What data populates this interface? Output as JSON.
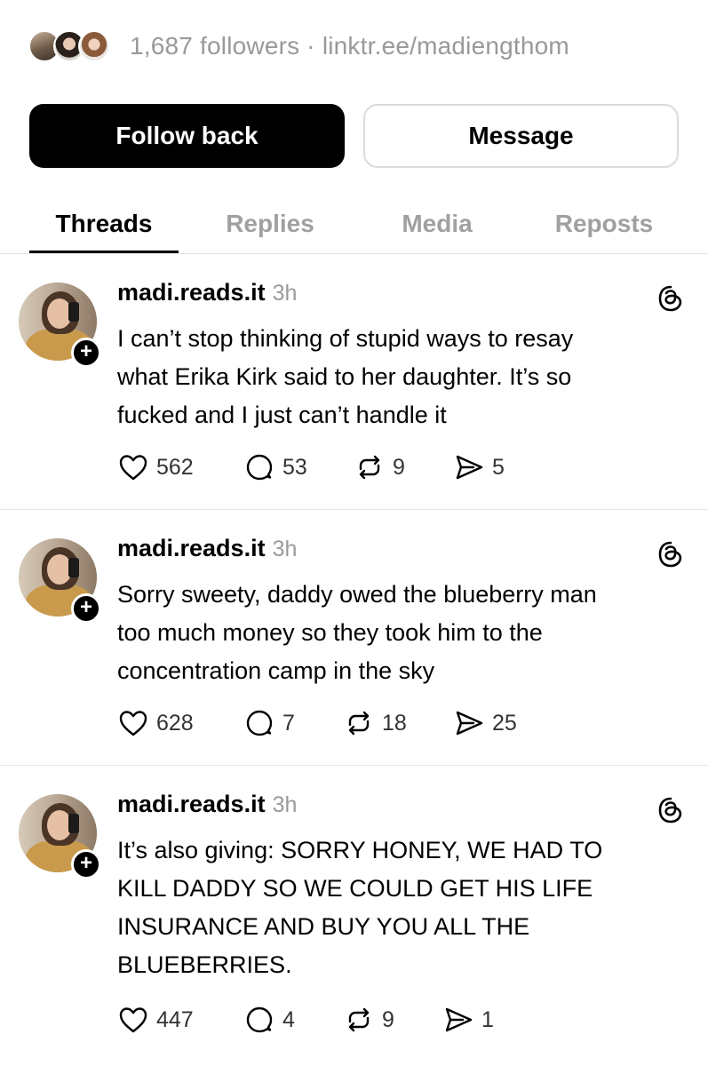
{
  "profile": {
    "followers_text": "1,687 followers · linktr.ee/madiengthom",
    "follow_back_label": "Follow back",
    "message_label": "Message"
  },
  "tabs": [
    {
      "label": "Threads",
      "active": true
    },
    {
      "label": "Replies",
      "active": false
    },
    {
      "label": "Media",
      "active": false
    },
    {
      "label": "Reposts",
      "active": false
    }
  ],
  "posts": [
    {
      "username": "madi.reads.it",
      "time": "3h",
      "text": "I can’t stop thinking of stupid ways to resay\nwhat Erika Kirk said to her daughter. It’s so\nfucked and I just can’t handle it",
      "likes": "562",
      "replies": "53",
      "reposts": "9",
      "shares": "5"
    },
    {
      "username": "madi.reads.it",
      "time": "3h",
      "text": "Sorry sweety, daddy owed the blueberry man\ntoo much money so they took him to the\nconcentration camp in the sky",
      "likes": "628",
      "replies": "7",
      "reposts": "18",
      "shares": "25"
    },
    {
      "username": "madi.reads.it",
      "time": "3h",
      "text": "It’s also giving: SORRY HONEY, WE HAD TO\nKILL DADDY SO WE COULD GET HIS LIFE\nINSURANCE AND BUY YOU ALL THE\nBLUEBERRIES.",
      "likes": "447",
      "replies": "4",
      "reposts": "9",
      "shares": "1"
    }
  ],
  "icons": {
    "follow_plus": "+",
    "like": "heart-icon",
    "reply": "comment-icon",
    "repost": "repost-icon",
    "share": "send-icon",
    "threads": "threads-logo-icon"
  },
  "colors": {
    "primary": "#000000",
    "muted_text": "#999999",
    "divider": "#e6e6e6"
  }
}
